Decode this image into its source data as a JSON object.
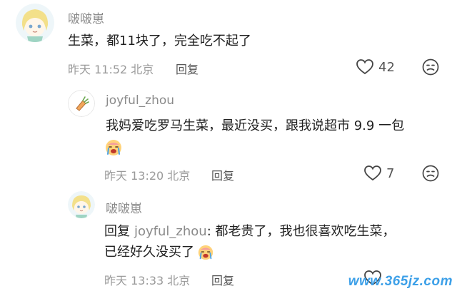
{
  "comments": [
    {
      "author": "啵啵崽",
      "text": "生菜，都11块了，完全吃不起了",
      "time": "昨天 11:52 北京",
      "reply_label": "回复",
      "likes": "42"
    },
    {
      "author": "joyful_zhou",
      "text": "我妈爱吃罗马生菜，最近没买，跟我说超市 9.9 一包",
      "time": "昨天 13:20 北京",
      "reply_label": "回复",
      "likes": "7"
    },
    {
      "author": "啵啵崽",
      "reply_prefix": "回复",
      "reply_to": "joyful_zhou",
      "text_line1": ": 都老贵了，我也很喜欢吃生菜，",
      "text_line2": "已经好久没买了",
      "time": "昨天 13:33 北京",
      "reply_label": "回复"
    }
  ],
  "watermark": "www.365jz.com",
  "icons": {
    "like": "heart-outline-icon",
    "dislike": "frown-face-icon",
    "crying_emoji": "crying-emoji-icon"
  },
  "colors": {
    "name": "#8a8a8a",
    "text": "#1e1e1e",
    "meta": "#9a9a9a",
    "watermark": "#3da0e8"
  }
}
